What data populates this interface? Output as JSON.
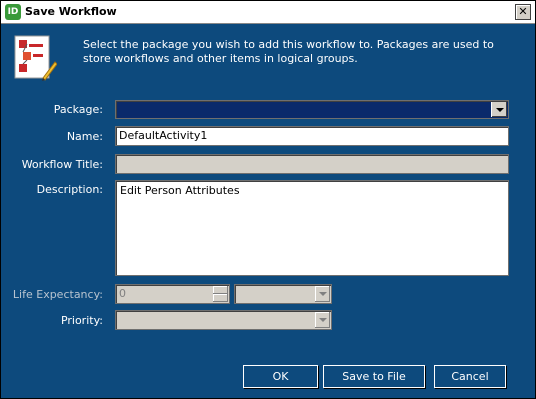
{
  "window": {
    "title": "Save Workflow",
    "app_icon_text": "ID",
    "close_label": "✕"
  },
  "intro_text": "Select the package you wish to add this workflow to. Packages are used to store workflows and other items in logical groups.",
  "form": {
    "package_label": "Package:",
    "package_value": "",
    "name_label": "Name:",
    "name_value": "DefaultActivity1",
    "workflow_title_label": "Workflow Title:",
    "workflow_title_value": "",
    "description_label": "Description:",
    "description_value": "Edit Person Attributes",
    "life_expectancy_label": "Life Expectancy:",
    "life_expectancy_value": "0",
    "life_expectancy_unit": "",
    "priority_label": "Priority:",
    "priority_value": ""
  },
  "buttons": {
    "ok": "OK",
    "save_to_file": "Save to File",
    "cancel": "Cancel"
  },
  "colors": {
    "dialog_background": "#0d4a7d",
    "package_select_fill": "#0a2a6b"
  }
}
